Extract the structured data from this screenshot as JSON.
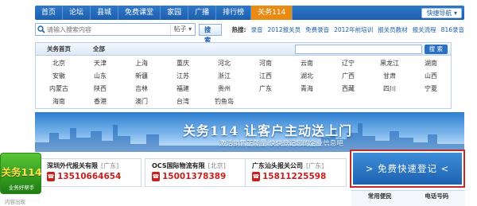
{
  "nav": {
    "items": [
      "首页",
      "论坛",
      "县城",
      "免费课堂",
      "家园",
      "广播",
      "排行榜",
      "关务114"
    ],
    "active_index": 7,
    "quick": "快捷导航"
  },
  "search": {
    "placeholder": "请输入搜索内容",
    "type": "帖子",
    "button": "搜索",
    "hot_label": "热搜:",
    "hot_words": [
      "录音",
      "2012报关员",
      "免费录音",
      "2012年前培训",
      "报关员教材",
      "报关流程",
      "816录音"
    ]
  },
  "city_panel": {
    "tabs": [
      "关务首页",
      "全部"
    ],
    "search_button": "搜 索",
    "cities": [
      "北京",
      "天津",
      "上海",
      "重庆",
      "河北",
      "河南",
      "云南",
      "辽宁",
      "黑龙江",
      "湖南",
      "安徽",
      "山东",
      "新疆",
      "江苏",
      "浙江",
      "江西",
      "湖北",
      "广西",
      "甘肃",
      "山西",
      "内蒙古",
      "陕西",
      "吉林",
      "福建",
      "贵州",
      "广东",
      "青海",
      "西藏",
      "四川",
      "宁夏",
      "海南",
      "香港",
      "澳门",
      "台湾",
      "钓鱼岛"
    ]
  },
  "banner": {
    "title": "关务114 让客户主动送上门",
    "subtitle": "激活销售正能量 快快登记您的企业信息吧"
  },
  "companies": [
    {
      "name": "深圳外代报关有限",
      "loc": "[广东]",
      "tel": "13510664654"
    },
    {
      "name": "OCS国际物流有限",
      "loc": "[北京]",
      "tel": "15001378389"
    },
    {
      "name": "广东汕头报关公司",
      "loc": "[广东]",
      "tel": "15811225598"
    }
  ],
  "register": {
    "label": "> 免费快速登记 <"
  },
  "table": {
    "headers": [
      "常用便民",
      "电话号码"
    ]
  },
  "badge": {
    "title": "关务114",
    "sub": "业务好帮手"
  },
  "footer": {
    "text": "内容出现"
  },
  "colors": {
    "nav": "#1d5fae",
    "accent": "#e98a12",
    "phone": "#c91f1f",
    "register_border": "#c02b2b"
  }
}
